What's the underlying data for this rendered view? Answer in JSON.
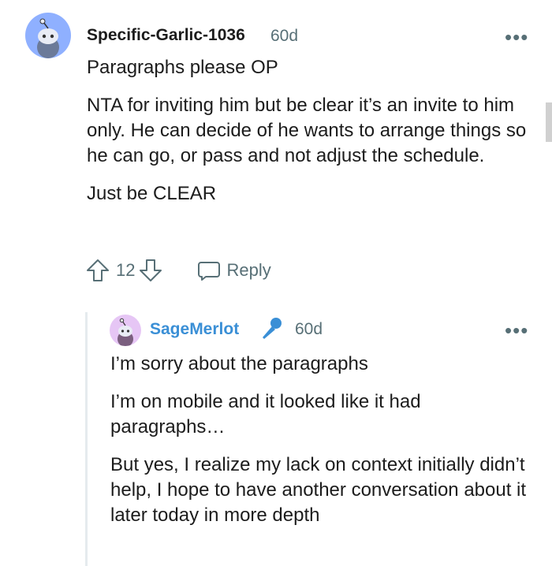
{
  "comment": {
    "username": "Specific-Garlic-1036",
    "time": "60d",
    "paragraphs": [
      "Paragraphs please OP",
      "NTA for inviting him but be clear it’s an invite to him only. He can decide of he wants to arrange things so he can go, or pass and not adjust the schedule.",
      "Just be CLEAR"
    ],
    "votes": "12",
    "reply_label": "Reply",
    "more_label": "•••"
  },
  "reply": {
    "username": "SageMerlot",
    "time": "60d",
    "paragraphs": [
      "I’m sorry about the paragraphs",
      "I’m on mobile and it looked like it had paragraphs…",
      "But yes, I realize my lack on context initially didn’t help, I hope to have another conversation about it later today in more depth"
    ],
    "more_label": "•••"
  },
  "colors": {
    "avatar_bg_main": "#8fb0ff",
    "avatar_bg_reply": "#e6c6f5",
    "username_reply": "#3a8fd6",
    "mic_icon": "#3a8fd6",
    "meta": "#576f76"
  }
}
